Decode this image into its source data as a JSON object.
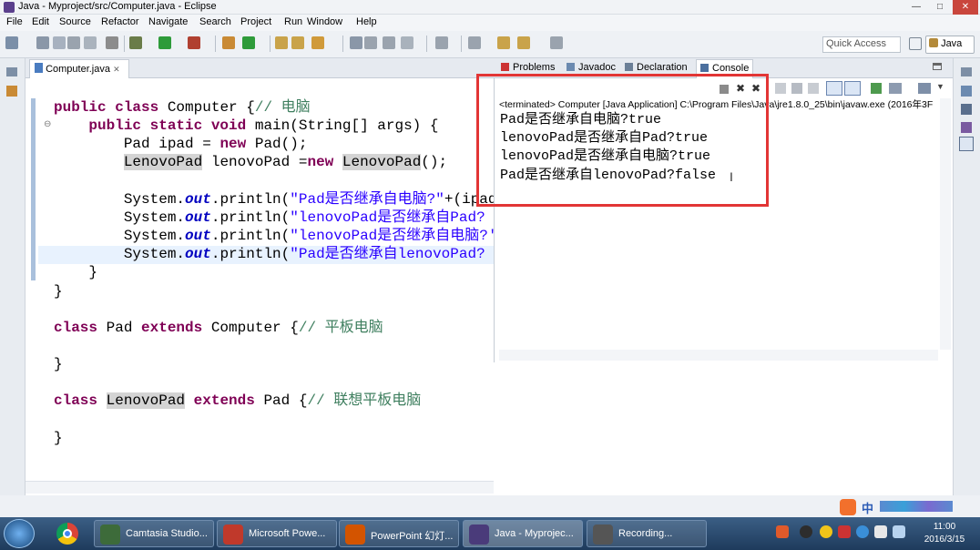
{
  "window": {
    "title": "Java - Myproject/src/Computer.java - Eclipse",
    "minimize": "—",
    "maximize": "□",
    "close": "✕"
  },
  "menu": [
    "File",
    "Edit",
    "Source",
    "Refactor",
    "Navigate",
    "Search",
    "Project",
    "Run",
    "Window",
    "Help"
  ],
  "toolbar": {
    "quick_access_placeholder": "Quick Access",
    "perspective": "Java"
  },
  "editor": {
    "tab_label": "Computer.java",
    "tab_close": "✕",
    "lines": [
      {
        "parts": [
          [
            "kw",
            "public class "
          ],
          [
            "",
            "Computer {"
          ],
          [
            "cm",
            "// 电脑"
          ]
        ]
      },
      {
        "parts": [
          [
            "kw",
            "    public static void "
          ],
          [
            "",
            "main(String[] "
          ],
          [
            "kw2",
            "args"
          ],
          [
            "",
            ") {"
          ]
        ]
      },
      {
        "parts": [
          [
            "",
            "        Pad "
          ],
          [
            "kw2",
            "ipad"
          ],
          [
            "",
            " = "
          ],
          [
            "kw",
            "new "
          ],
          [
            "",
            "Pad();"
          ]
        ]
      },
      {
        "parts": [
          [
            "",
            "        "
          ],
          [
            "hl",
            "LenovoPad"
          ],
          [
            "",
            " "
          ],
          [
            "kw2",
            "lenovoPad"
          ],
          [
            "",
            " ="
          ],
          [
            "kw",
            "new "
          ],
          [
            "hl",
            "LenovoPad"
          ],
          [
            "",
            "();"
          ]
        ]
      },
      {
        "parts": []
      },
      {
        "parts": [
          [
            "",
            "        System."
          ],
          [
            "fd",
            "out"
          ],
          [
            "",
            ".println("
          ],
          [
            "st",
            "\"Pad是否继承自电脑?\""
          ],
          [
            "",
            "+(ipad"
          ]
        ]
      },
      {
        "parts": [
          [
            "",
            "        System."
          ],
          [
            "fd",
            "out"
          ],
          [
            "",
            ".println("
          ],
          [
            "st",
            "\"lenovoPad是否继承自Pad?"
          ]
        ]
      },
      {
        "parts": [
          [
            "",
            "        System."
          ],
          [
            "fd",
            "out"
          ],
          [
            "",
            ".println("
          ],
          [
            "st",
            "\"lenovoPad是否继承自电脑?'"
          ]
        ]
      },
      {
        "parts": [
          [
            "",
            "        System."
          ],
          [
            "fd",
            "out"
          ],
          [
            "",
            ".println("
          ],
          [
            "st",
            "\"Pad是否继承自lenovoPad?"
          ]
        ]
      },
      {
        "parts": [
          [
            "",
            "    }"
          ]
        ]
      },
      {
        "parts": [
          [
            "",
            "}"
          ]
        ]
      },
      {
        "parts": []
      },
      {
        "parts": [
          [
            "kw",
            "class "
          ],
          [
            "",
            "Pad "
          ],
          [
            "kw",
            "extends "
          ],
          [
            "",
            "Computer {"
          ],
          [
            "cm",
            "// 平板电脑"
          ]
        ]
      },
      {
        "parts": []
      },
      {
        "parts": [
          [
            "",
            "}"
          ]
        ]
      },
      {
        "parts": []
      },
      {
        "parts": [
          [
            "kw",
            "class "
          ],
          [
            "hl",
            "LenovoPad"
          ],
          [
            "",
            " "
          ],
          [
            "kw",
            "extends "
          ],
          [
            "",
            "Pad {"
          ],
          [
            "cm",
            "// 联想平板电脑"
          ]
        ]
      },
      {
        "parts": []
      },
      {
        "parts": [
          [
            "",
            "}"
          ]
        ]
      }
    ]
  },
  "console_panel": {
    "tabs": [
      "Problems",
      "Javadoc",
      "Declaration",
      "Console"
    ],
    "header": "<terminated> Computer [Java Application] C:\\Program Files\\Java\\jre1.8.0_25\\bin\\javaw.exe (2016年3F",
    "output": [
      "Pad是否继承自电脑?true",
      "lenovoPad是否继承自Pad?true",
      "lenovoPad是否继承自电脑?true",
      "Pad是否继承自lenovoPad?false"
    ]
  },
  "taskbar": {
    "tasks": [
      "Camtasia Studio...",
      "Microsoft Powe...",
      "PowerPoint 幻灯...",
      "Java - Myprojec...",
      "Recording..."
    ],
    "time": "11:00",
    "date": "2016/3/15",
    "ime": "中"
  },
  "colors": {
    "keyword": "#7f0055",
    "comment": "#3f7f5f",
    "string": "#2a00ff",
    "field": "#0000c0",
    "highlight_box": "#e23535"
  }
}
